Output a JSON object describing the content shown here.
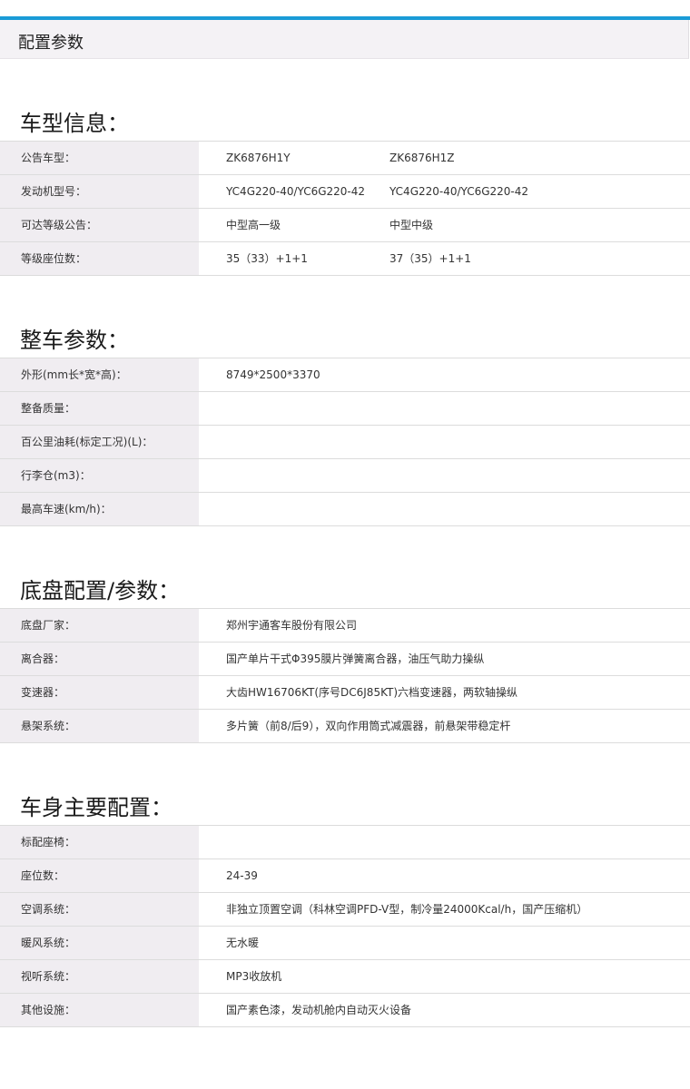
{
  "header": {
    "title": "配置参数"
  },
  "sections": [
    {
      "title": "车型信息：",
      "rows": [
        {
          "label": "公告车型：",
          "values": [
            "ZK6876H1Y",
            "ZK6876H1Z"
          ]
        },
        {
          "label": "发动机型号：",
          "values": [
            "YC4G220-40/YC6G220-42",
            "YC4G220-40/YC6G220-42"
          ]
        },
        {
          "label": "可达等级公告：",
          "values": [
            "中型高一级",
            "中型中级"
          ]
        },
        {
          "label": "等级座位数：",
          "values": [
            "35（33）+1+1",
            "37（35）+1+1"
          ]
        }
      ]
    },
    {
      "title": "整车参数：",
      "rows": [
        {
          "label": "外形(mm长*宽*高)：",
          "values": [
            "8749*2500*3370"
          ]
        },
        {
          "label": "整备质量：",
          "values": []
        },
        {
          "label": "百公里油耗(标定工况)(L)：",
          "values": []
        },
        {
          "label": "行李仓(m3)：",
          "values": []
        },
        {
          "label": "最高车速(km/h)：",
          "values": []
        }
      ]
    },
    {
      "title": "底盘配置/参数：",
      "rows": [
        {
          "label": "底盘厂家：",
          "values": [
            "郑州宇通客车股份有限公司"
          ]
        },
        {
          "label": "离合器：",
          "values": [
            "国产单片干式Φ395膜片弹簧离合器，油压气助力操纵"
          ]
        },
        {
          "label": "变速器：",
          "values": [
            "大齿HW16706KT(序号DC6J85KT)六档变速器，两软轴操纵"
          ]
        },
        {
          "label": "悬架系统：",
          "values": [
            "多片簧（前8/后9），双向作用筒式减震器，前悬架带稳定杆"
          ]
        }
      ]
    },
    {
      "title": "车身主要配置：",
      "rows": [
        {
          "label": "标配座椅：",
          "values": []
        },
        {
          "label": "座位数：",
          "values": [
            "24-39"
          ]
        },
        {
          "label": "空调系统：",
          "values": [
            "非独立顶置空调（科林空调PFD-V型，制冷量24000Kcal/h，国产压缩机）"
          ]
        },
        {
          "label": "暖风系统：",
          "values": [
            "无水暖"
          ]
        },
        {
          "label": "视听系统：",
          "values": [
            "MP3收放机"
          ]
        },
        {
          "label": "其他设施：",
          "values": [
            "国产素色漆，发动机舱内自动灭火设备"
          ]
        }
      ]
    }
  ]
}
